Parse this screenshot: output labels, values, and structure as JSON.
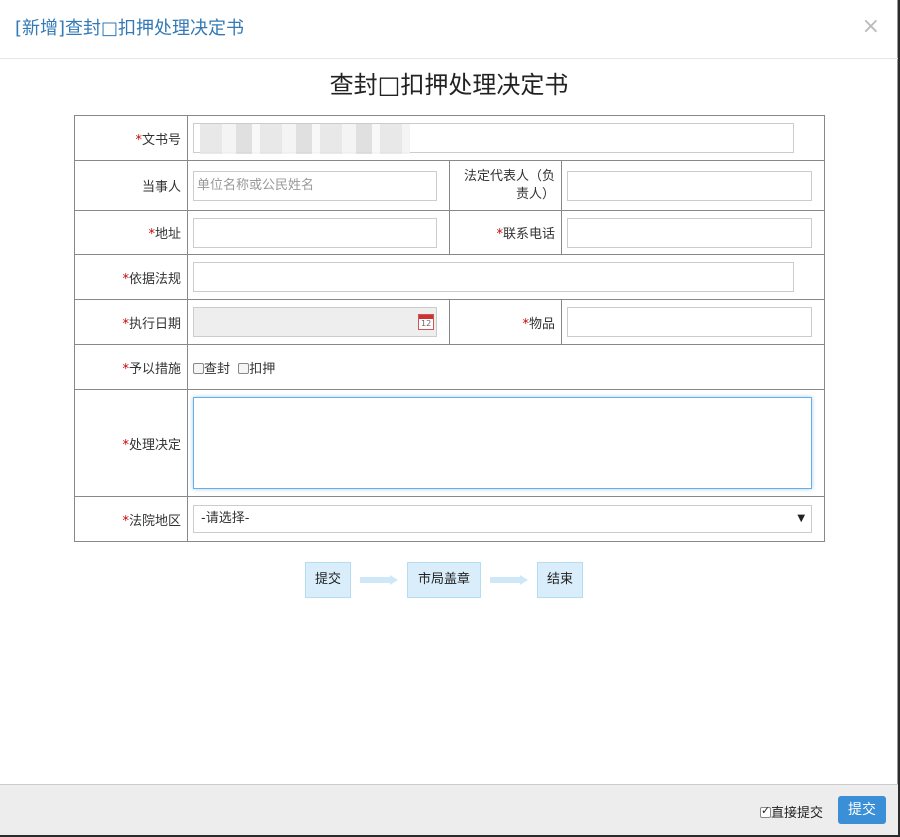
{
  "header": {
    "title": "[新增]查封□扣押处理决定书",
    "close": "×"
  },
  "doc_title": "查封□扣押处理决定书",
  "form": {
    "required_mark": "*",
    "doc_number_label": "文书号",
    "party_label": "当事人",
    "party_placeholder": "单位名称或公民姓名",
    "legal_rep_label": "法定代表人（负责人）",
    "address_label": "地址",
    "phone_label": "联系电话",
    "law_basis_label": "依据法规",
    "exec_date_label": "执行日期",
    "items_label": "物品",
    "measures_label": "予以措施",
    "measure_seal": "查封",
    "measure_detain": "扣押",
    "decision_label": "处理决定",
    "court_region_label": "法院地区",
    "court_region_value": "-请选择-"
  },
  "flow": [
    "提交",
    "市局盖章",
    "结束"
  ],
  "footer": {
    "direct_submit_label": "直接提交",
    "direct_submit_checked": true,
    "submit_label": "提交"
  },
  "colors": {
    "title": "#337ab7",
    "flow_node": "#d9eefa",
    "flow_arrow": "#cfe8f7",
    "submit": "#3a8fd6",
    "required": "#c00"
  }
}
